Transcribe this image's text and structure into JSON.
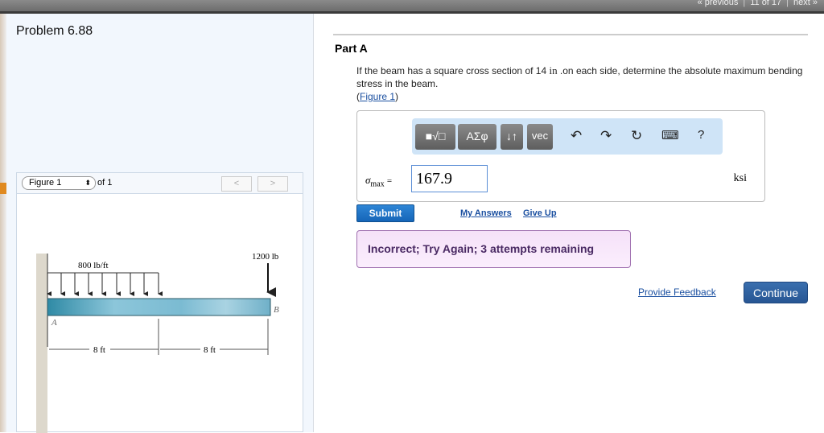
{
  "topnav": {
    "previous": "« previous",
    "position": "11 of 17",
    "next": "next »"
  },
  "problem_title": "Problem 6.88",
  "figure": {
    "select_value": "Figure 1",
    "of_label": "of 1",
    "prev": "<",
    "next": ">",
    "labels": {
      "load": "800 lb/ft",
      "point_load": "1200 lb",
      "A": "A",
      "B": "B",
      "dim1": "8 ft",
      "dim2": "8 ft"
    }
  },
  "part": {
    "title": "Part A",
    "question_pre": "If the beam has a square cross section of 14 ",
    "question_unit": "in",
    "question_post": " .on each side, determine the absolute maximum bending stress in the beam.",
    "figure_link": "Figure 1"
  },
  "toolbar": {
    "templates": "■√□",
    "greek": "ΑΣφ",
    "arrows": "↓↑",
    "vec": "vec",
    "undo": "↶",
    "redo": "↷",
    "reset": "↻",
    "keyboard": "⌨",
    "help": "?"
  },
  "answer": {
    "variable": "σ",
    "subscript": "max",
    "equals": "=",
    "value": "167.9",
    "unit": "ksi"
  },
  "actions": {
    "submit": "Submit",
    "my_answers": "My Answers",
    "give_up": "Give Up"
  },
  "feedback": "Incorrect; Try Again; 3 attempts remaining",
  "footer": {
    "provide_feedback": "Provide Feedback",
    "continue": "Continue"
  }
}
